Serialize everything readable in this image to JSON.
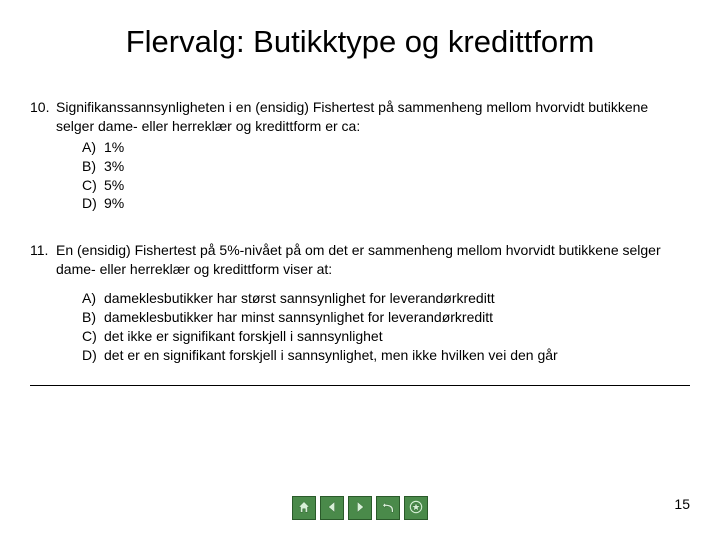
{
  "title": "Flervalg: Butikktype og kredittform",
  "questions": [
    {
      "number": "10.",
      "text": "Signifikanssannsynligheten i en (ensidig) Fishertest på sammenheng mellom hvorvidt butikkene selger dame- eller herreklær og kredittform er ca:",
      "options": [
        {
          "label": "A)",
          "text": "1%"
        },
        {
          "label": "B)",
          "text": "3%"
        },
        {
          "label": "C)",
          "text": "5%"
        },
        {
          "label": "D)",
          "text": "9%"
        }
      ]
    },
    {
      "number": "11.",
      "text": "En (ensidig) Fishertest på 5%-nivået på om det er sammenheng mellom hvorvidt butikkene selger dame- eller herreklær og kredittform viser at:",
      "options": [
        {
          "label": "A)",
          "text": "dameklesbutikker har størst sannsynlighet for leverandørkreditt"
        },
        {
          "label": "B)",
          "text": "dameklesbutikker har minst sannsynlighet for leverandørkreditt"
        },
        {
          "label": "C)",
          "text": "det ikke er signifikant forskjell i sannsynlighet"
        },
        {
          "label": "D)",
          "text": "det er en signifikant forskjell i sannsynlighet, men ikke hvilken vei den går"
        }
      ]
    }
  ],
  "nav": {
    "home": "home-icon",
    "prev": "prev-icon",
    "next": "next-icon",
    "back": "back-icon",
    "menu": "menu-icon"
  },
  "page_number": "15"
}
